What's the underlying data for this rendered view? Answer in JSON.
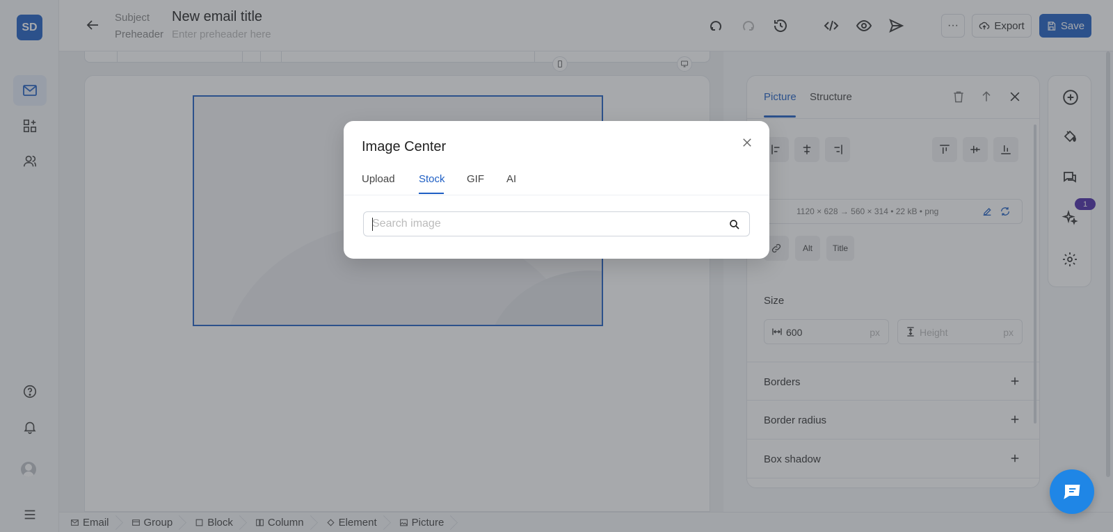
{
  "app": {
    "logo": "SD"
  },
  "topbar": {
    "subject_label": "Subject",
    "preheader_label": "Preheader",
    "title": "New email title",
    "preheader_placeholder": "Enter preheader here",
    "more_label": "···",
    "export_label": "Export",
    "save_label": "Save"
  },
  "picture_panel": {
    "tabs": [
      "Picture",
      "Structure"
    ],
    "active_tab": "Picture",
    "image_info": "1120 × 628 → 560 × 314  •  22 kB  •  png",
    "alt_label": "Alt",
    "title_label": "Title",
    "size_label": "Size",
    "width_value": "600",
    "height_placeholder": "Height",
    "unit": "px",
    "sections": [
      "Borders",
      "Border radius",
      "Box shadow"
    ]
  },
  "toolrail": {
    "badge_count": "1"
  },
  "breadcrumb": [
    "Email",
    "Group",
    "Block",
    "Column",
    "Element",
    "Picture"
  ],
  "modal": {
    "title": "Image Center",
    "tabs": [
      "Upload",
      "Stock",
      "GIF",
      "AI"
    ],
    "active_tab": "Stock",
    "search_placeholder": "Search image",
    "search_value": ""
  },
  "colors": {
    "accent": "#1f5fc4",
    "badge": "#4b2aa8",
    "chat_fab": "#1f86e6"
  }
}
